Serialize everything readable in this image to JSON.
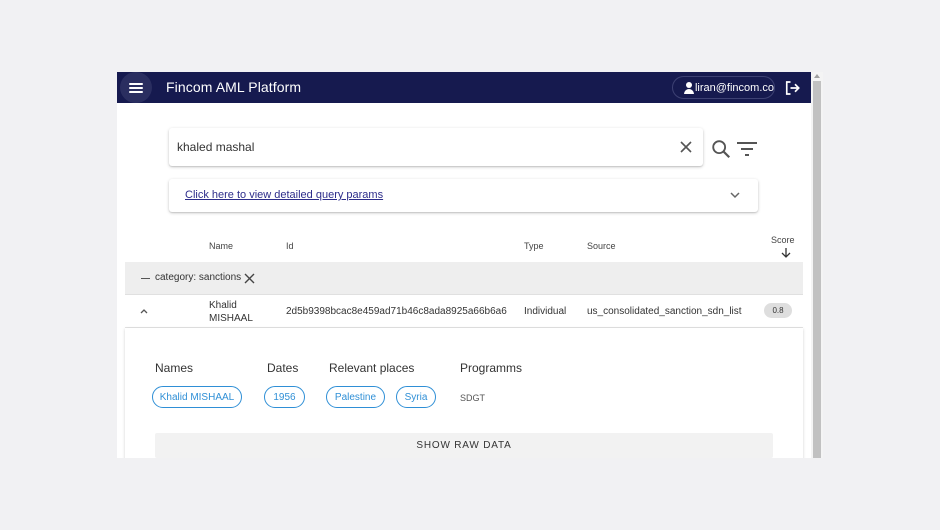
{
  "appbar": {
    "title": "Fincom AML Platform",
    "user_email": "liran@fincom.co",
    "bg_color": "#161a4f",
    "icons": [
      "menu-icon",
      "user-icon",
      "logout-icon"
    ]
  },
  "search": {
    "value": "khaled mashal",
    "icons": [
      "close-icon",
      "search-icon",
      "filter-icon"
    ]
  },
  "params": {
    "link_text": "Click here to view detailed query params"
  },
  "table": {
    "headers": {
      "name": "Name",
      "id": "Id",
      "type": "Type",
      "source": "Source",
      "score": "Score"
    },
    "group": {
      "label": "category: sanctions"
    },
    "rows": [
      {
        "name_line1": "Khalid",
        "name_line2": "MISHAAL",
        "id": "2d5b9398bcac8e459ad71b46c8ada8925a66b6a6",
        "type": "Individual",
        "source": "us_consolidated_sanction_sdn_list",
        "score": "0.8"
      }
    ]
  },
  "details": {
    "names_label": "Names",
    "dates_label": "Dates",
    "places_label": "Relevant places",
    "programs_label": "Programms",
    "names": [
      "Khalid MISHAAL"
    ],
    "dates": [
      "1956"
    ],
    "places": [
      "Palestine",
      "Syria"
    ],
    "programs": [
      "SDGT"
    ],
    "raw_button": "SHOW RAW DATA",
    "chip_color": "#2f8fd6"
  }
}
